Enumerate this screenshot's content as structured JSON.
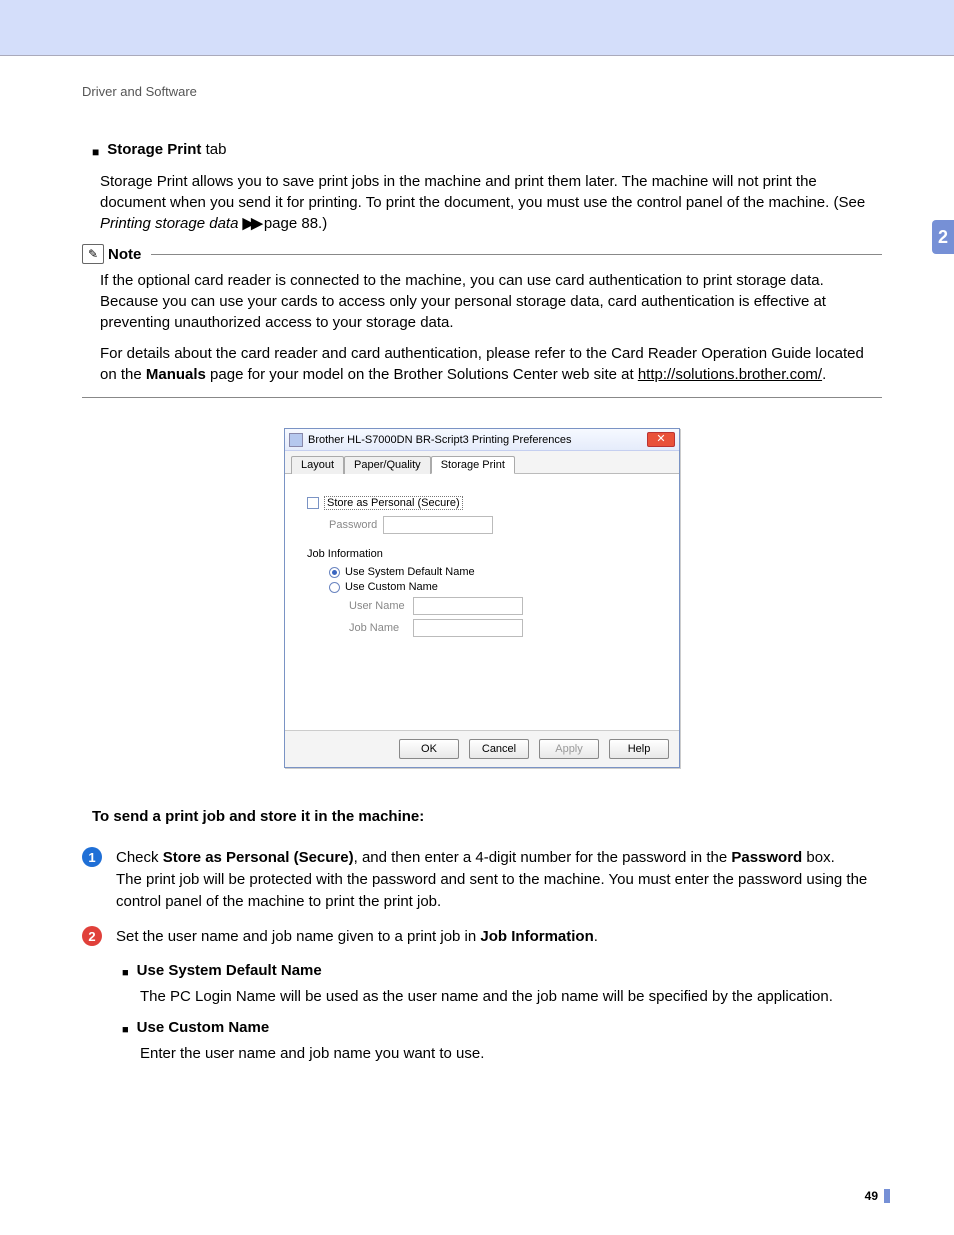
{
  "breadcrumb": "Driver and Software",
  "page_tab": "2",
  "page_number": "49",
  "section1": {
    "title_bold": "Storage Print",
    "title_rest": " tab",
    "para_before": "Storage Print allows you to save print jobs in the machine and print them later. The machine will not print the document when you send it for printing. To print the document, you must use the control panel of the machine. (See ",
    "para_italic": "Printing storage data",
    "para_after": " page 88.)"
  },
  "note": {
    "label": "Note",
    "body1": "If the optional card reader is connected to the machine, you can use card authentication to print storage data. Because you can use your cards to access only your personal storage data, card authentication is effective at preventing unauthorized access to your storage data.",
    "body2_a": "For details about the card reader and card authentication, please refer to the Card Reader Operation Guide located on the ",
    "body2_bold": "Manuals",
    "body2_b": " page for your model on the Brother Solutions Center web site at ",
    "body2_link": "http://solutions.brother.com/",
    "body2_c": "."
  },
  "dialog": {
    "title": "Brother HL-S7000DN BR-Script3 Printing Preferences",
    "tabs": [
      "Layout",
      "Paper/Quality",
      "Storage Print"
    ],
    "active_tab": 2,
    "store_label": "Store as Personal (Secure)",
    "password_label": "Password",
    "group": "Job Information",
    "radio1": "Use System Default Name",
    "radio2": "Use Custom Name",
    "user_label": "User Name",
    "job_label": "Job Name",
    "buttons": {
      "ok": "OK",
      "cancel": "Cancel",
      "apply": "Apply",
      "help": "Help"
    }
  },
  "howto_title": "To send a print job and store it in the machine:",
  "steps": [
    {
      "num": "1",
      "a": "Check ",
      "b1": "Store as Personal (Secure)",
      "c": ", and then enter a 4-digit number for the password in the ",
      "b2": "Password",
      "d": " box.",
      "line2": "The print job will be protected with the password and sent to the machine. You must enter the password using the control panel of the machine to print the print job."
    },
    {
      "num": "2",
      "a": "Set the user name and job name given to a print job in ",
      "b1": "Job Information",
      "d": "."
    }
  ],
  "subitems": [
    {
      "head": "Use System Default Name",
      "para": "The PC Login Name will be used as the user name and the job name will be specified by the application."
    },
    {
      "head": "Use Custom Name",
      "para": "Enter the user name and job name you want to use."
    }
  ]
}
